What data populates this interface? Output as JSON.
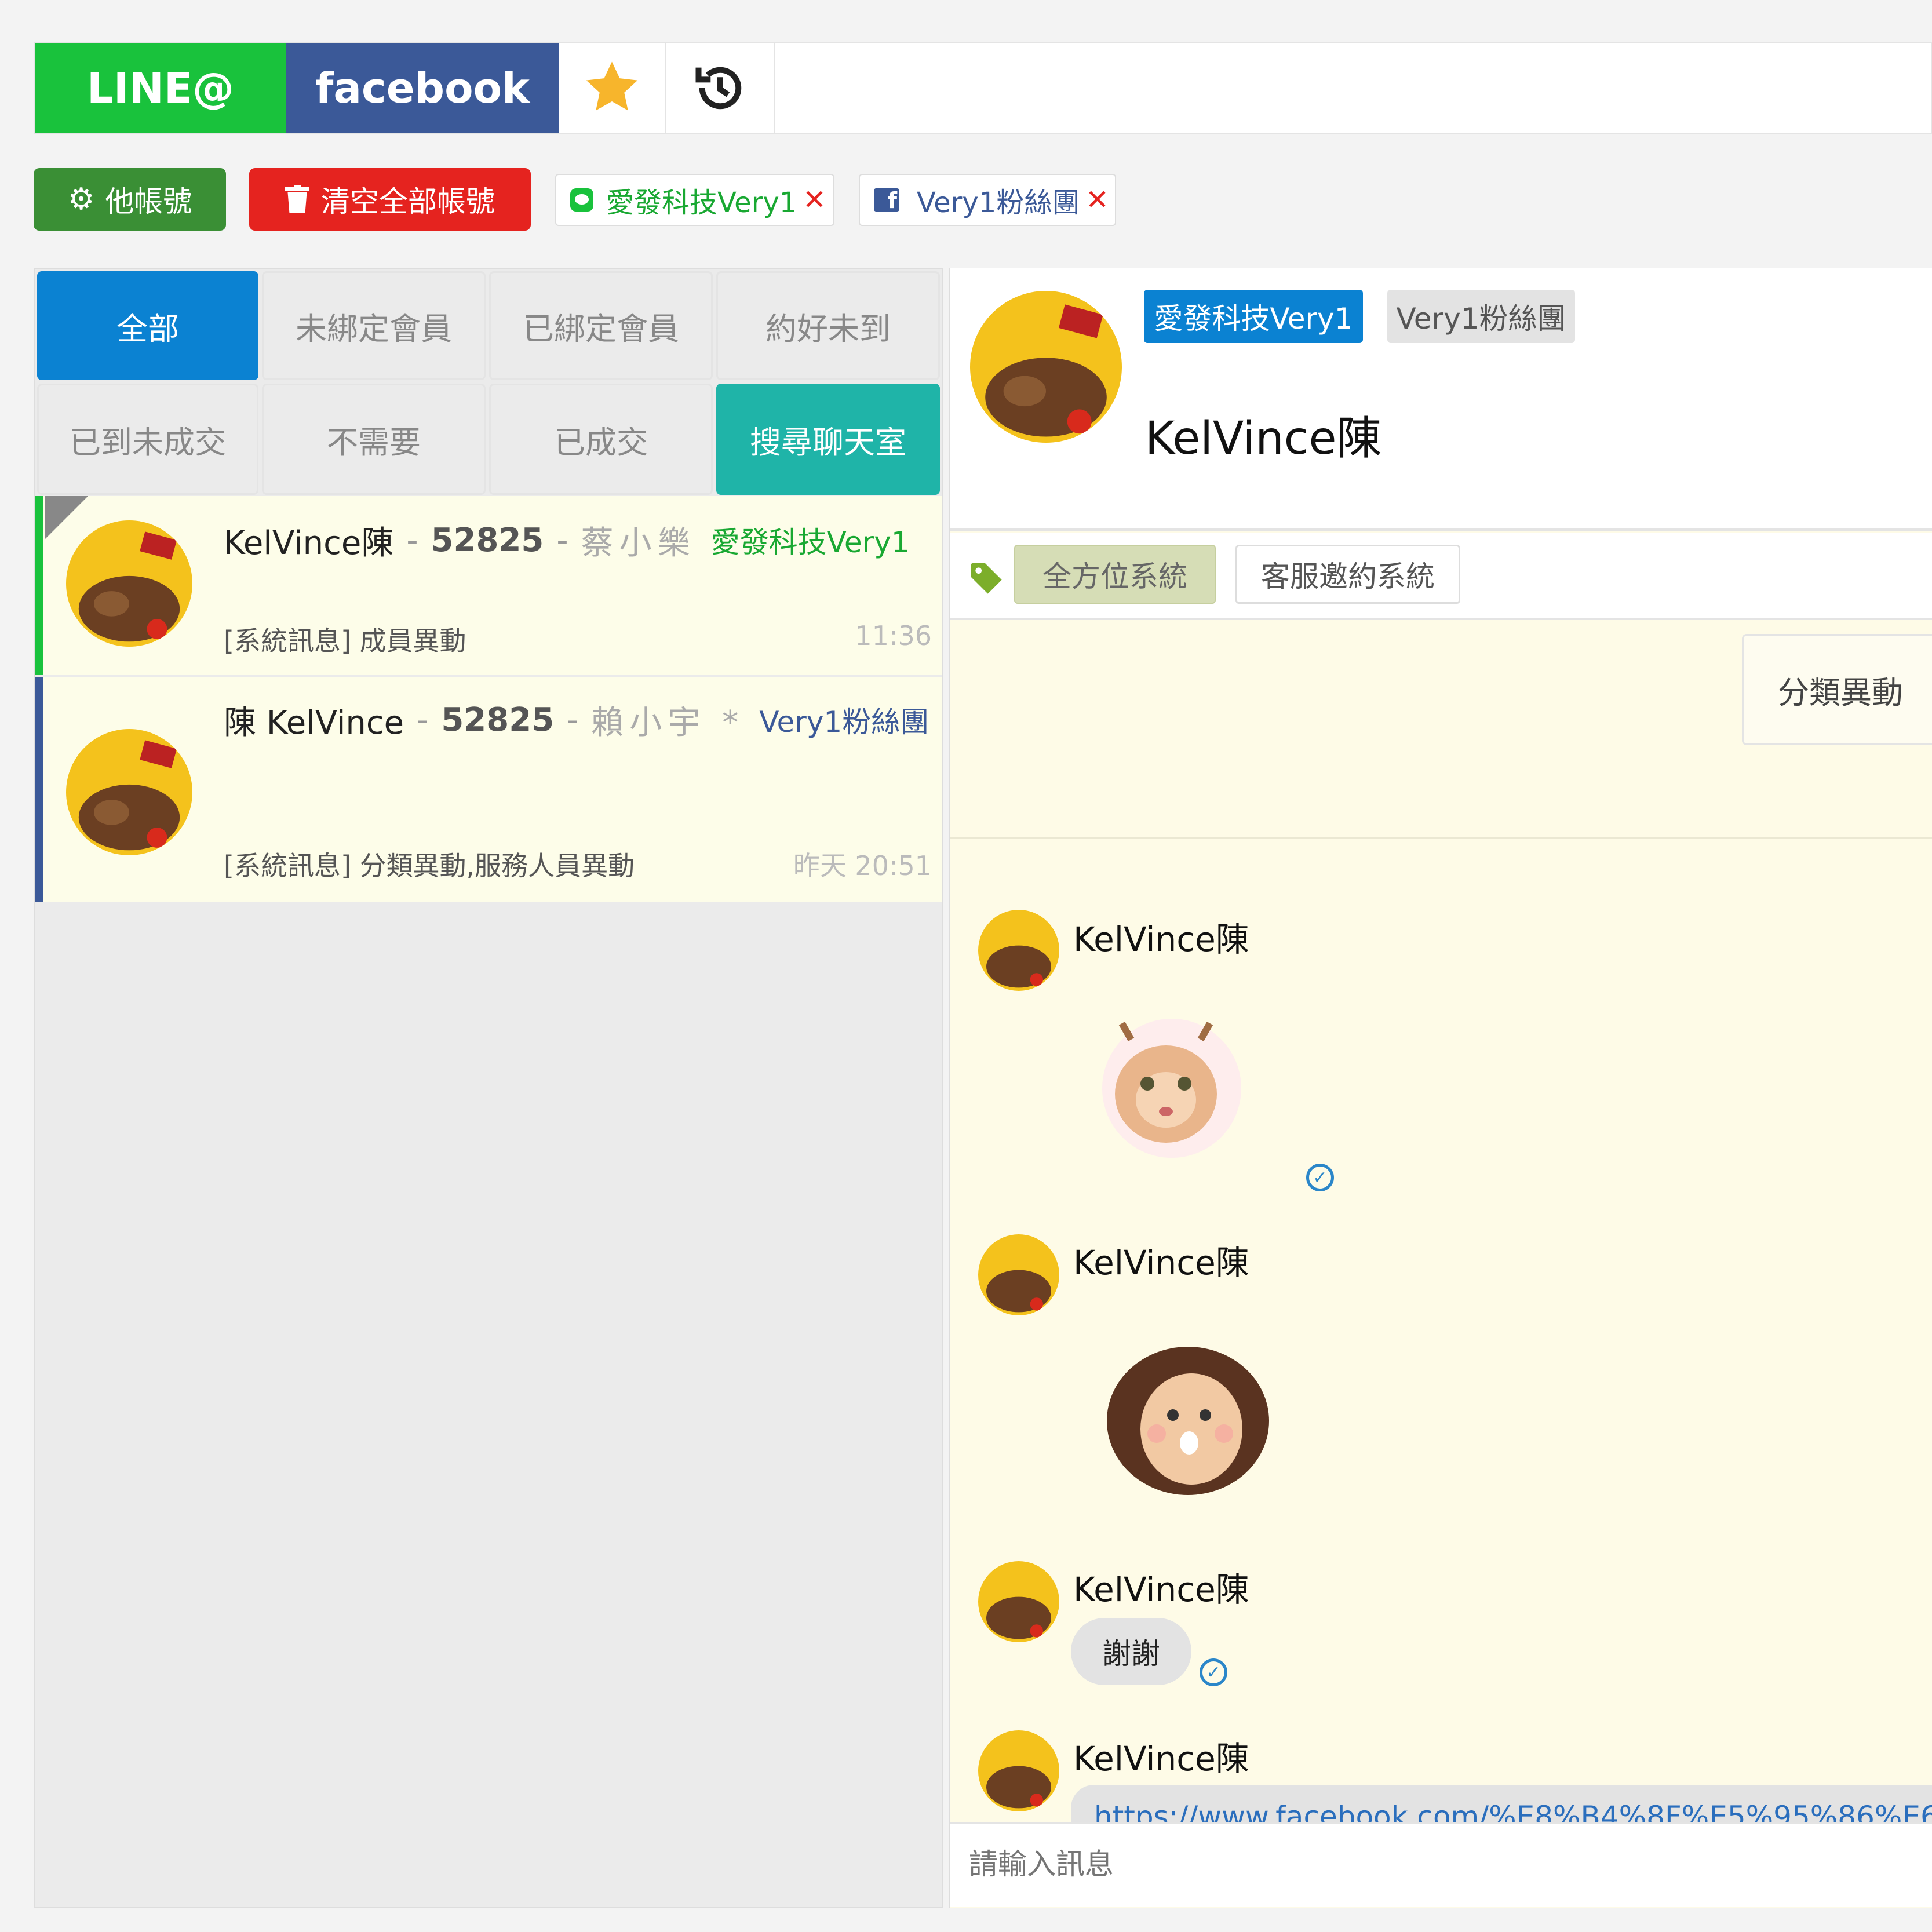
{
  "platform_tabs": {
    "line": "LINE@",
    "facebook": "facebook"
  },
  "toolbar": {
    "other_accounts": "他帳號",
    "clear_all": "清空全部帳號",
    "account_chips": [
      {
        "label": "愛發科技Very1",
        "platform": "line"
      },
      {
        "label": "Very1粉絲團",
        "platform": "facebook"
      }
    ]
  },
  "filters": {
    "row1": [
      "全部",
      "未綁定會員",
      "已綁定會員",
      "約好未到"
    ],
    "row2": [
      "已到未成交",
      "不需要",
      "已成交",
      "搜尋聊天室"
    ]
  },
  "conversations": [
    {
      "name": "KelVince陳",
      "sep1": "-",
      "code": "52825",
      "sep2": "-",
      "agent": "蔡小樂",
      "account": "愛發科技Very1",
      "preview": "[系統訊息] 成員異動",
      "time": "11:36"
    },
    {
      "name": "陳 KelVince",
      "sep1": "-",
      "code": "52825",
      "sep2": "-",
      "agent": "賴小宇 *",
      "account": "Very1粉絲團",
      "preview": "[系統訊息] 分類異動,服務人員異動",
      "time": "昨天 20:51"
    }
  ],
  "contact": {
    "accounts": [
      "愛發科技Very1",
      "Very1粉絲團"
    ],
    "name": "KelVince陳",
    "tags": [
      "全方位系統",
      "客服邀約系統"
    ],
    "event_label": "分類異動"
  },
  "messages": [
    {
      "sender": "KelVince陳",
      "type": "sticker"
    },
    {
      "sender": "KelVince陳",
      "type": "sticker"
    },
    {
      "sender": "KelVince陳",
      "type": "text",
      "text": "謝謝"
    },
    {
      "sender": "KelVince陳",
      "type": "link",
      "text": "https://www.facebook.com/%E8%B4%8F%E5%95%86%E6%"
    }
  ],
  "composer": {
    "placeholder": "請輸入訊息"
  },
  "colors": {
    "line_green": "#19c23c",
    "facebook_blue": "#3b5998",
    "active_blue": "#0b82d2",
    "search_teal": "#1fb4a8",
    "danger_red": "#e5231f",
    "dark_green": "#3a8f35"
  }
}
